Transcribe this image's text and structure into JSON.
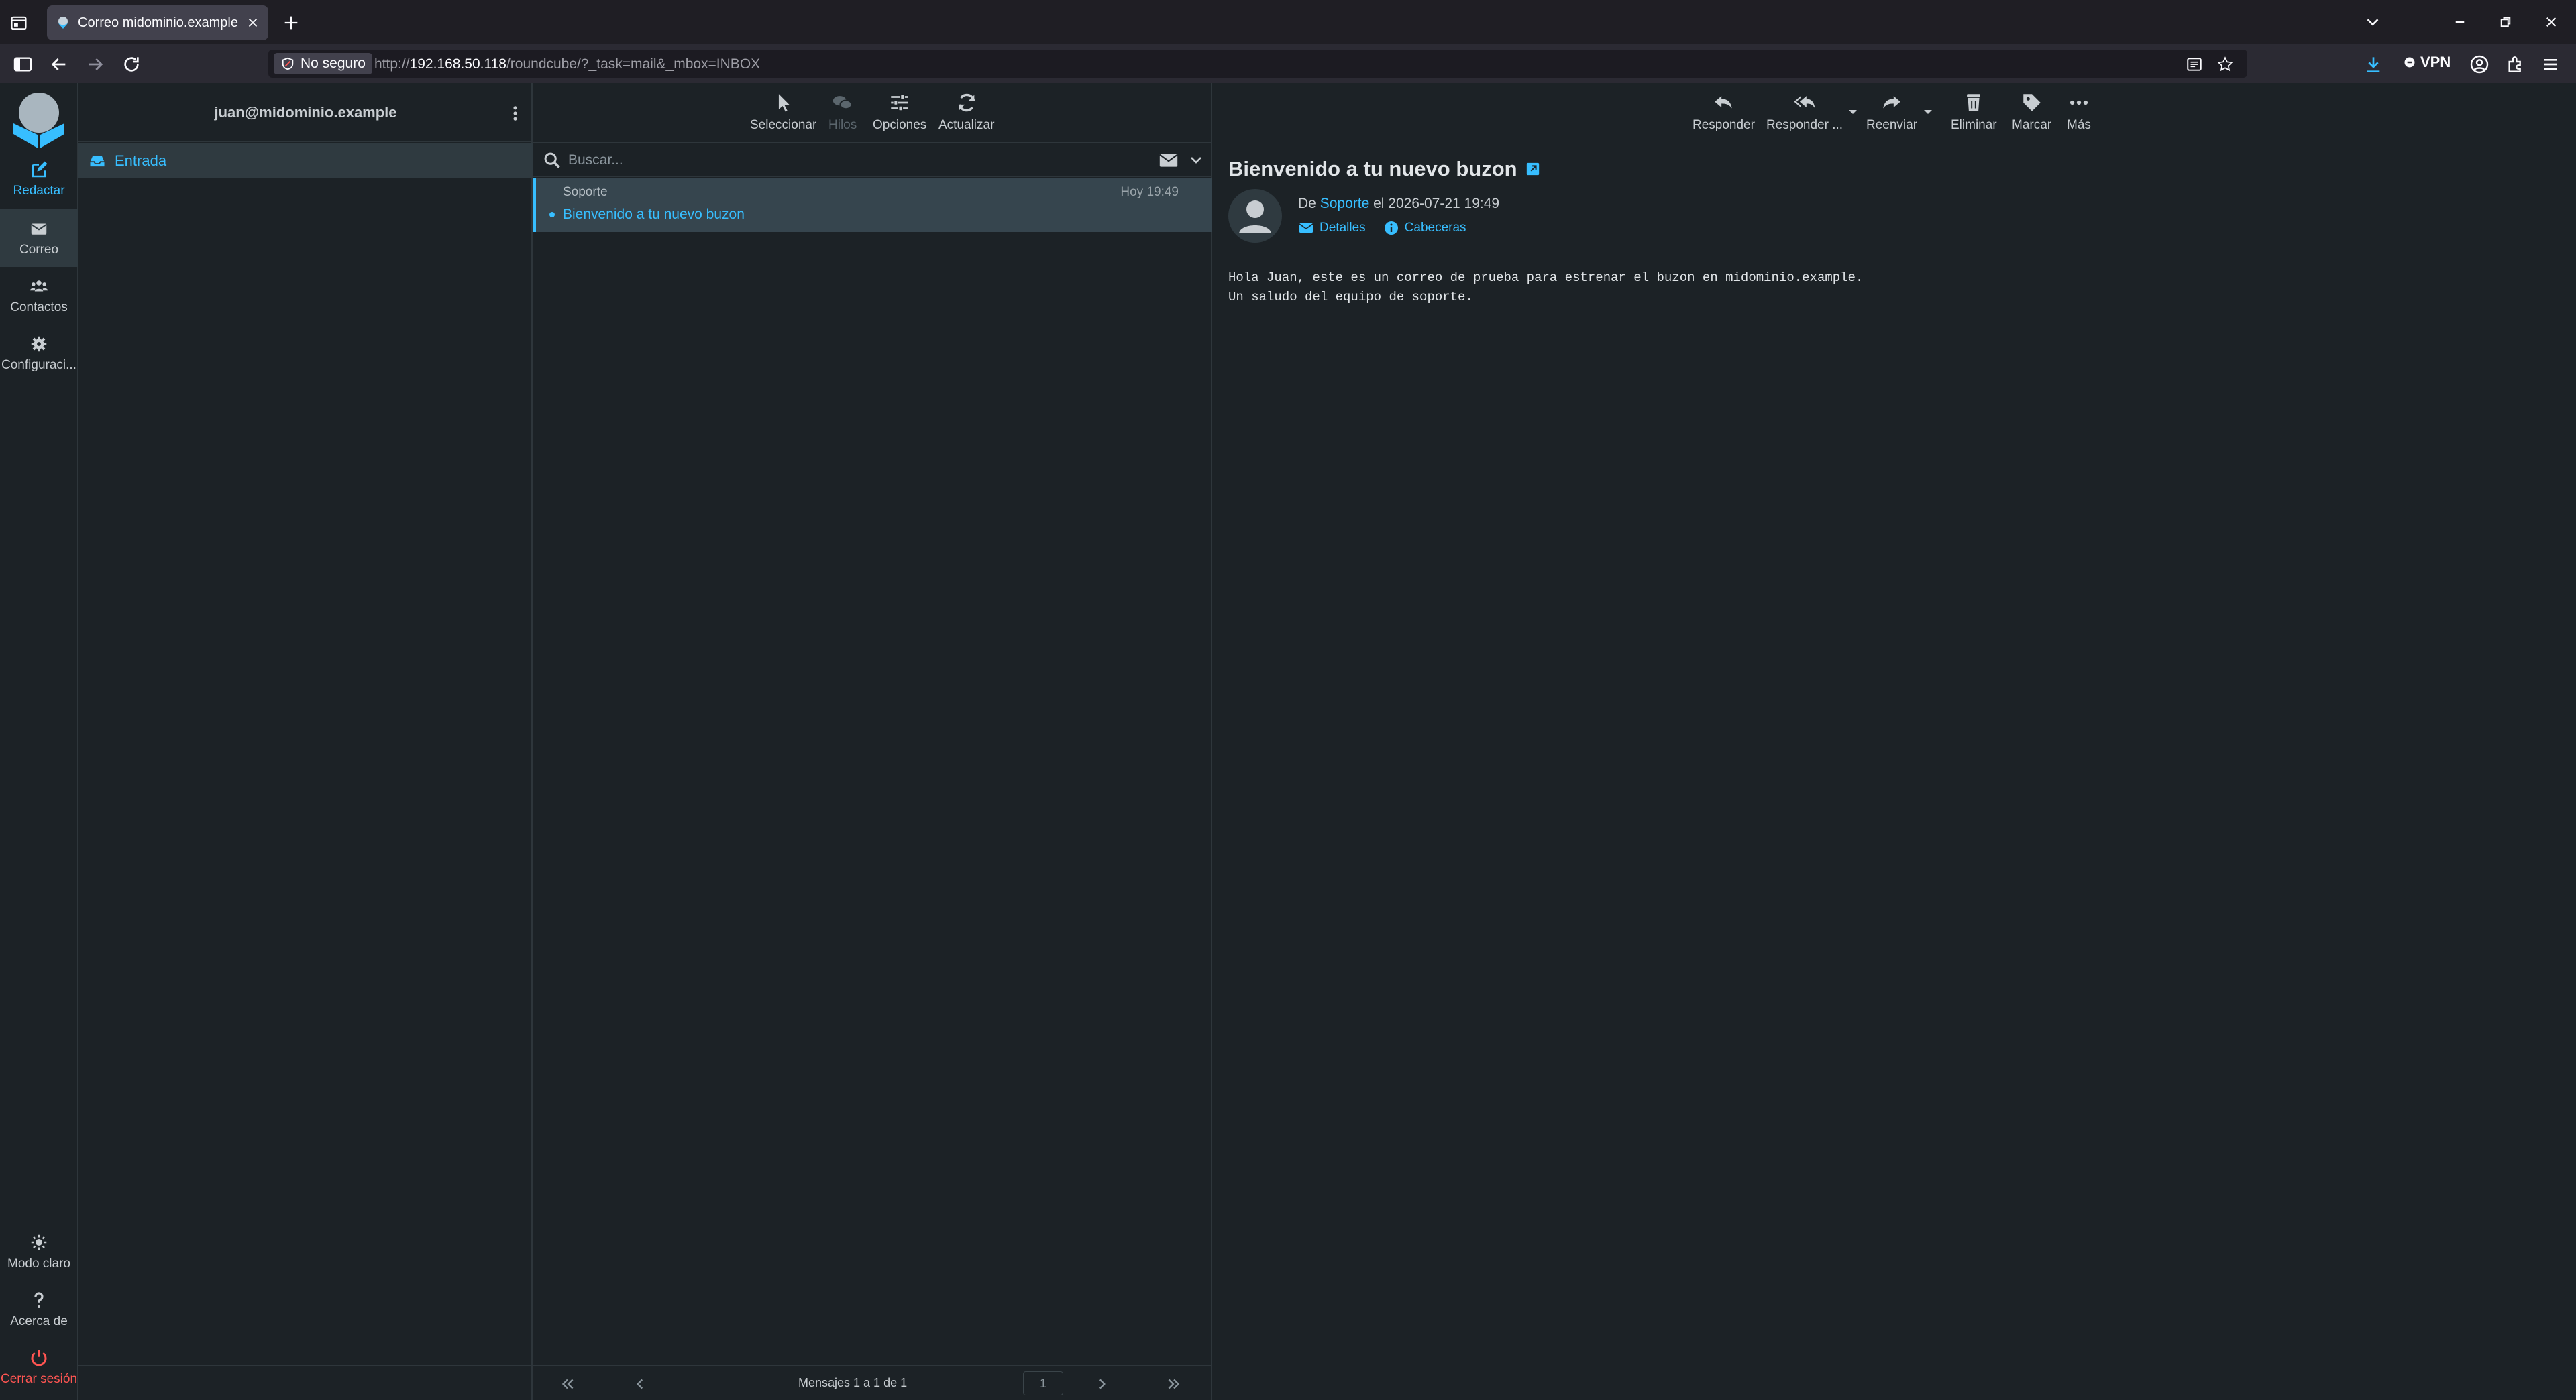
{
  "browser": {
    "tab_title": "Correo midominio.example :: Entrada",
    "security_label": "No seguro",
    "url_prefix": "http://",
    "url_host": "192.168.50.118",
    "url_path": "/roundcube/?_task=mail&_mbox=INBOX",
    "vpn_label": "VPN"
  },
  "sidebar": {
    "compose": "Redactar",
    "mail": "Correo",
    "contacts": "Contactos",
    "settings": "Configuraci...",
    "light_mode": "Modo claro",
    "about": "Acerca de",
    "logout": "Cerrar sesión"
  },
  "folders": {
    "account": "juan@midominio.example",
    "items": [
      {
        "label": "Entrada",
        "icon": "inbox-icon"
      }
    ]
  },
  "list_toolbar": {
    "select": "Seleccionar",
    "threads": "Hilos",
    "options": "Opciones",
    "refresh": "Actualizar"
  },
  "search": {
    "placeholder": "Buscar..."
  },
  "messages": [
    {
      "from": "Soporte",
      "date": "Hoy 19:49",
      "subject": "Bienvenido a tu nuevo buzon",
      "unread": true
    }
  ],
  "pagination": {
    "text": "Mensajes 1 a 1 de 1",
    "page": "1"
  },
  "reader_toolbar": {
    "reply": "Responder",
    "reply_all": "Responder ...",
    "forward": "Reenviar",
    "delete": "Eliminar",
    "mark": "Marcar",
    "more": "Más"
  },
  "message": {
    "subject": "Bienvenido a tu nuevo buzon",
    "from_prefix": "De",
    "from_name": "Soporte",
    "date_text": "el 2026-07-21 19:49",
    "details_label": "Detalles",
    "headers_label": "Cabeceras",
    "body": "Hola Juan, este es un correo de prueba para estrenar el buzon en midominio.example.\nUn saludo del equipo de soporte."
  },
  "colors": {
    "accent": "#37beff",
    "background": "#1c2226",
    "selected_row": "#36454e",
    "logout": "#ff5552"
  }
}
